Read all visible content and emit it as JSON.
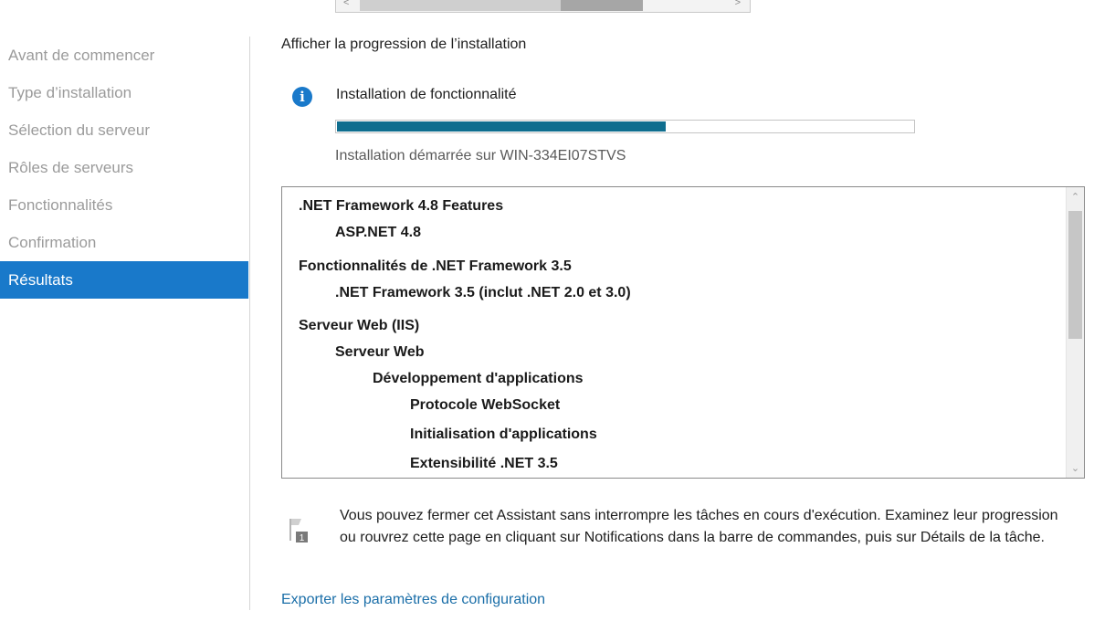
{
  "sidebar": {
    "items": [
      {
        "label": "Avant de commencer",
        "active": false
      },
      {
        "label": "Type d’installation",
        "active": false
      },
      {
        "label": "Sélection du serveur",
        "active": false
      },
      {
        "label": "Rôles de serveurs",
        "active": false
      },
      {
        "label": "Fonctionnalités",
        "active": false
      },
      {
        "label": "Confirmation",
        "active": false
      },
      {
        "label": "Résultats",
        "active": true
      }
    ]
  },
  "main": {
    "title": "Afficher la progression de l’installation",
    "status": {
      "icon": "info-icon",
      "text": "Installation de fonctionnalité",
      "progress_fraction": 0.57,
      "started_text": "Installation démarrée sur WIN-334EI07STVS"
    },
    "features": [
      {
        "label": ".NET Framework 4.8 Features",
        "level": 0
      },
      {
        "label": "ASP.NET 4.8",
        "level": 1
      },
      {
        "label": "Fonctionnalités de .NET Framework 3.5",
        "level": 0
      },
      {
        "label": ".NET Framework 3.5 (inclut .NET 2.0 et 3.0)",
        "level": 1
      },
      {
        "label": "Serveur Web (IIS)",
        "level": 0
      },
      {
        "label": "Serveur Web",
        "level": 1
      },
      {
        "label": "Développement d'applications",
        "level": 2
      },
      {
        "label": "Protocole WebSocket",
        "level": 3
      },
      {
        "label": "Initialisation d'applications",
        "level": 3
      },
      {
        "label": "Extensibilité .NET 3.5",
        "level": 3
      }
    ],
    "notice": {
      "icon": "flag-notification-icon",
      "badge": "1",
      "text": "Vous pouvez fermer cet Assistant sans interrompre les tâches en cours d'exécution. Examinez leur progression ou rouvrez cette page en cliquant sur Notifications dans la barre de commandes, puis sur Détails de la tâche."
    },
    "export_link": "Exporter les paramètres de configuration"
  },
  "colors": {
    "accent": "#1979ca",
    "progress_fill": "#0f6e8f",
    "link": "#1a6ea8",
    "disabled_text": "#9b9b9b"
  }
}
